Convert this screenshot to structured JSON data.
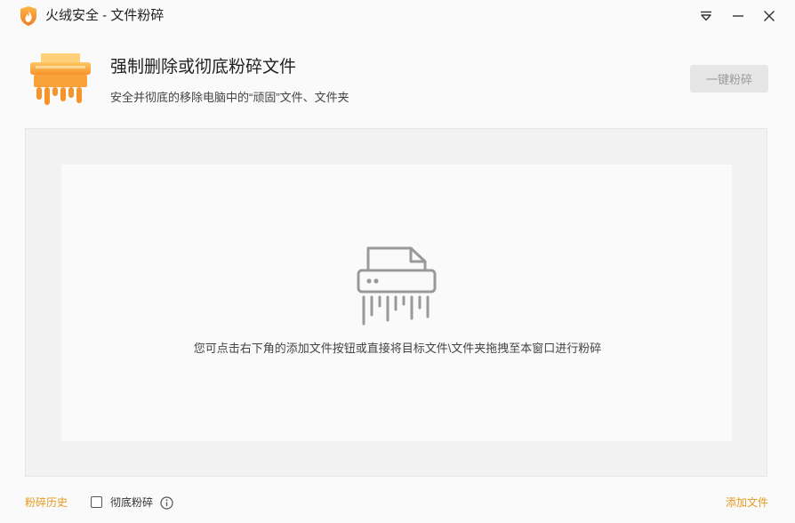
{
  "window": {
    "title": "火绒安全 - 文件粉碎",
    "icons": [
      "flame-logo-icon",
      "menu-dropdown-icon",
      "minimize-icon",
      "close-icon"
    ]
  },
  "header": {
    "title": "强制删除或彻底粉碎文件",
    "subtitle": "安全并彻底的移除电脑中的“顽固”文件、文件夹",
    "shred_button": "一键粉碎",
    "icon": "shredder-orange-icon"
  },
  "dropzone": {
    "hint": "您可点击右下角的添加文件按钮或直接将目标文件\\文件夹拖拽至本窗口进行粉碎",
    "icon": "shredder-icon"
  },
  "footer": {
    "history_link": "粉碎历史",
    "thorough_checkbox_label": "彻底粉碎",
    "thorough_checked": false,
    "add_file_link": "添加文件"
  },
  "colors": {
    "accent": "#e69a20",
    "icon_gradient_top": "#ffc766",
    "icon_gradient_bottom": "#f7932b",
    "disabled_button_bg": "#e6e6e6",
    "disabled_button_text": "#9a9a9a"
  }
}
